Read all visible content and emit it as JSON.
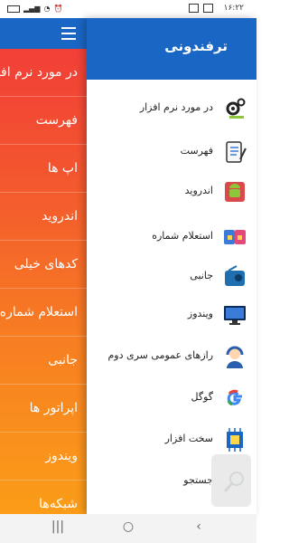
{
  "status_bar": {
    "time": "۱۶:۲۲"
  },
  "app_bar": {
    "title": "ترفندونی"
  },
  "background_menu": [
    "در مورد نرم افزار",
    "فهرست",
    "اپ ها",
    "اندروید",
    "کدهای خیلی",
    "استعلام شماره",
    "جانبی",
    "اپراتور ها",
    "ویندوز",
    "شبکه‌ها"
  ],
  "drawer": {
    "items": [
      {
        "label": "در مورد نرم افزار",
        "icon": "gear-icon"
      },
      {
        "label": "فهرست",
        "icon": "notebook-icon"
      },
      {
        "label": "اندروید",
        "icon": "android-icon"
      },
      {
        "label": "استعلام شماره",
        "icon": "sim-card-icon"
      },
      {
        "label": "جانبی",
        "icon": "radio-icon"
      },
      {
        "label": "ویندوز",
        "icon": "monitor-icon"
      },
      {
        "label": "رازهای عمومی سری دوم",
        "icon": "support-agent-icon"
      },
      {
        "label": "گوگل",
        "icon": "google-icon"
      },
      {
        "label": "سخت افزار",
        "icon": "chip-icon"
      },
      {
        "label": "جستجو",
        "icon": "search-icon"
      }
    ]
  },
  "colors": {
    "primary": "#1a66c4",
    "gradient_top": "#f13a3a",
    "gradient_bottom": "#fb9d18"
  }
}
